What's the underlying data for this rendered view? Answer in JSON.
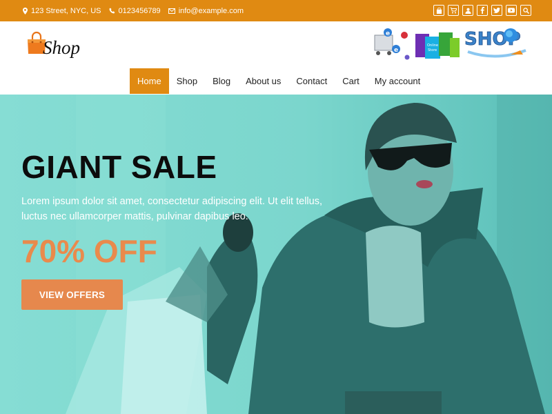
{
  "topbar": {
    "address": "123 Street, NYC, US",
    "phone": "0123456789",
    "email": "info@example.com",
    "socials": [
      "bag-icon",
      "cart-icon",
      "user-icon",
      "facebook-icon",
      "twitter-icon",
      "youtube-icon",
      "search-icon"
    ],
    "color": "#e08a12"
  },
  "logo": {
    "text": "Shop"
  },
  "banner": {
    "text": "SHOP"
  },
  "nav": {
    "items": [
      "Home",
      "Shop",
      "Blog",
      "About us",
      "Contact",
      "Cart",
      "My account"
    ],
    "active": "Home"
  },
  "hero": {
    "title": "GIANT SALE",
    "text": "Lorem ipsum dolor sit amet, consectetur adipiscing elit. Ut elit tellus, luctus nec ullamcorper mattis, pulvinar dapibus leo.",
    "offer": "70% OFF",
    "button": "VIEW OFFERS",
    "accent": "#e6884d"
  }
}
